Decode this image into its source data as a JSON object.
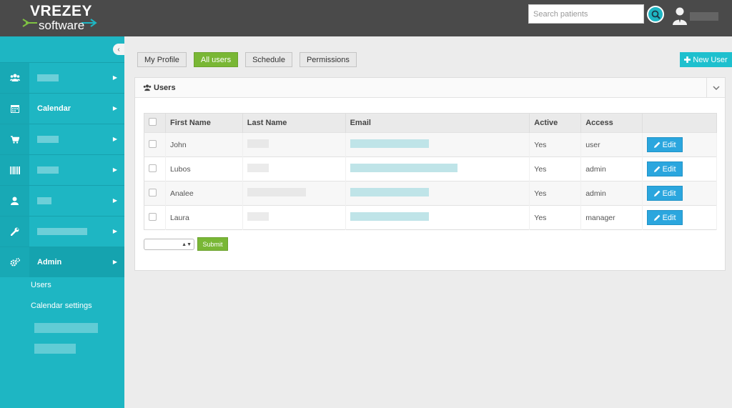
{
  "header": {
    "logo_top": "VREZEY",
    "logo_bottom": "software",
    "search_placeholder": "Search patients"
  },
  "sidebar": {
    "collapse_glyph": "‹",
    "items": [
      {
        "icon": "users-icon",
        "label": ""
      },
      {
        "icon": "calendar-icon",
        "label": "Calendar"
      },
      {
        "icon": "cart-icon",
        "label": ""
      },
      {
        "icon": "barcode-icon",
        "label": ""
      },
      {
        "icon": "user-icon",
        "label": ""
      },
      {
        "icon": "wrench-icon",
        "label": ""
      },
      {
        "icon": "cogs-icon",
        "label": "Admin"
      }
    ],
    "subitems": [
      "Users",
      "Calendar settings"
    ]
  },
  "tabs": [
    "My Profile",
    "All users",
    "Schedule",
    "Permissions"
  ],
  "active_tab": "All users",
  "new_user_label": "New User",
  "panel": {
    "title": "Users"
  },
  "table": {
    "headers": [
      "First Name",
      "Last Name",
      "Email",
      "Active",
      "Access"
    ],
    "rows": [
      {
        "first": "John",
        "active": "Yes",
        "access": "user",
        "edit": "Edit"
      },
      {
        "first": "Lubos",
        "active": "Yes",
        "access": "admin",
        "edit": "Edit"
      },
      {
        "first": "Analee",
        "active": "Yes",
        "access": "admin",
        "edit": "Edit"
      },
      {
        "first": "Laura",
        "active": "Yes",
        "access": "manager",
        "edit": "Edit"
      }
    ]
  },
  "submit_label": "Submit",
  "colors": {
    "header_bg": "#4a4a4a",
    "sidebar_bg": "#1eb6c3",
    "accent_green": "#79b735",
    "edit_blue": "#2ba6de",
    "new_user_teal": "#1ec0ce"
  }
}
